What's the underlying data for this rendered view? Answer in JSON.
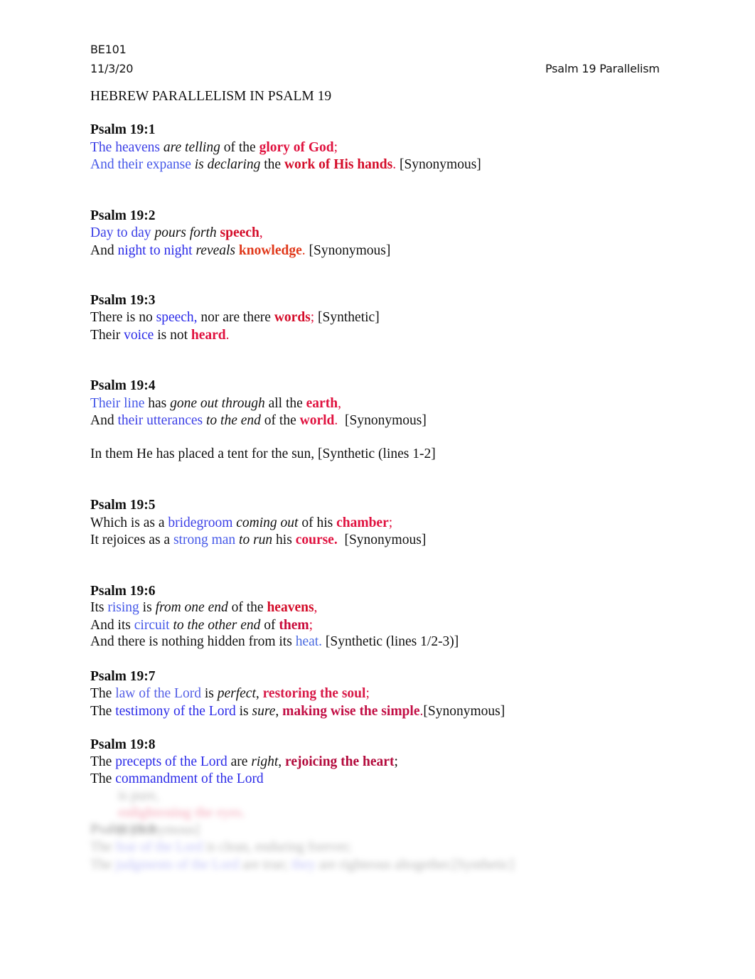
{
  "header": {
    "course": "BE101",
    "date": "11/3/20",
    "doc_title": "Psalm 19 Parallelism"
  },
  "document": {
    "heading": "HEBREW PARALLELISM IN PSALM 19",
    "colors": {
      "subject_blue": "#3b3fe6",
      "object_red": "#e0123f",
      "object_orange": "#e0381a"
    },
    "v1": {
      "ref": "Psalm 19:1",
      "l1": [
        "The heavens",
        " are telling",
        " of the ",
        "glory of God",
        ";"
      ],
      "l2": [
        "And their expanse",
        " is declaring",
        " the ",
        "work of His hands",
        ".",
        " [Synonymous]"
      ]
    },
    "v2": {
      "ref": "Psalm 19:2",
      "l1": [
        "Day to day",
        " pours forth",
        " ",
        "speech",
        ","
      ],
      "l2": [
        "And ",
        "night to night",
        " reveals",
        " ",
        "knowledge",
        ".",
        " [Synonymous]"
      ]
    },
    "v3": {
      "ref": "Psalm 19:3",
      "l1": [
        "There is no ",
        "speech,",
        " nor are there ",
        "words",
        ";",
        " [Synthetic]"
      ],
      "l2": [
        "Their ",
        "voice",
        " is not ",
        "heard",
        "."
      ]
    },
    "v4": {
      "ref": "Psalm 19:4",
      "l1": [
        "Their line",
        " has ",
        "gone out through",
        " all the ",
        "earth",
        ","
      ],
      "l2": [
        "And ",
        "their utterances",
        " to the end",
        " of the ",
        "world",
        ".",
        "  [Synonymous]"
      ],
      "l3": "In them He has placed a tent for the sun, [Synthetic (lines 1-2]"
    },
    "v5": {
      "ref": "Psalm 19:5",
      "l1": [
        "Which is as a ",
        "bridegroom",
        " coming out",
        " of his ",
        "chamber",
        ";"
      ],
      "l2": [
        "It rejoices as a ",
        "strong man",
        " to run",
        " his ",
        "course.",
        "  [Synonymous]"
      ]
    },
    "v6": {
      "ref": "Psalm 19:6",
      "l1": [
        "Its ",
        "rising",
        " is ",
        "from one end",
        " of the ",
        "heavens",
        ","
      ],
      "l2": [
        "And its ",
        "circuit",
        " to the other end",
        " of ",
        "them",
        ";"
      ],
      "l3": [
        "And there is nothing hidden from its ",
        "heat.",
        " [Synthetic (lines 1/2-3)]"
      ]
    },
    "v7": {
      "ref": "Psalm 19:7",
      "l1": [
        "The ",
        "law of the Lord",
        " is ",
        "perfect",
        ", ",
        "restoring the soul",
        ";"
      ],
      "l2": [
        "The ",
        "testimony of the Lord",
        " is ",
        "sure",
        ", ",
        "making wise the simple",
        ".",
        "[Synonymous]"
      ]
    },
    "v8": {
      "ref": "Psalm 19:8",
      "l1": [
        "The ",
        "precepts of the Lord",
        " are ",
        "right",
        ", ",
        "rejoicing the heart",
        ";"
      ],
      "l2": [
        "The ",
        "commandment of the Lord"
      ],
      "l2_blurred": [
        "is pure,",
        "enlightening the eyes.",
        "[Synonymous]"
      ]
    },
    "v9_blurred": {
      "ref": "Psalm 19:9",
      "l1": [
        "The ",
        "fear of the Lord",
        " is clean, enduring forever;"
      ],
      "l2": [
        "The ",
        "judgments of the Lord",
        " are true; ",
        "they",
        " are righteous altogether.[Synthetic]"
      ]
    }
  }
}
